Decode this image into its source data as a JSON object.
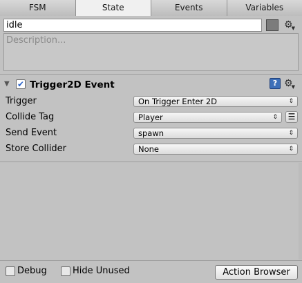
{
  "tabs": [
    {
      "label": "FSM",
      "active": false
    },
    {
      "label": "State",
      "active": true
    },
    {
      "label": "Events",
      "active": false
    },
    {
      "label": "Variables",
      "active": false
    }
  ],
  "state": {
    "name": "idle",
    "description_placeholder": "Description..."
  },
  "action": {
    "title": "Trigger2D Event",
    "enabled": true,
    "params": [
      {
        "label": "Trigger",
        "value": "On Trigger Enter 2D"
      },
      {
        "label": "Collide Tag",
        "value": "Player"
      },
      {
        "label": "Send Event",
        "value": "spawn"
      },
      {
        "label": "Store Collider",
        "value": "None"
      }
    ]
  },
  "footer": {
    "debug_label": "Debug",
    "debug_checked": false,
    "hide_unused_label": "Hide Unused",
    "hide_unused_checked": false,
    "action_browser_label": "Action Browser"
  },
  "icons": {
    "gear": "gear-icon",
    "help": "help-book-icon",
    "foldout": "triangle-down-icon",
    "list": "list-icon"
  },
  "colors": {
    "panel_bg": "#c2c2c2",
    "active_tab": "#f0f0f0",
    "swatch": "#7c7c7c"
  }
}
